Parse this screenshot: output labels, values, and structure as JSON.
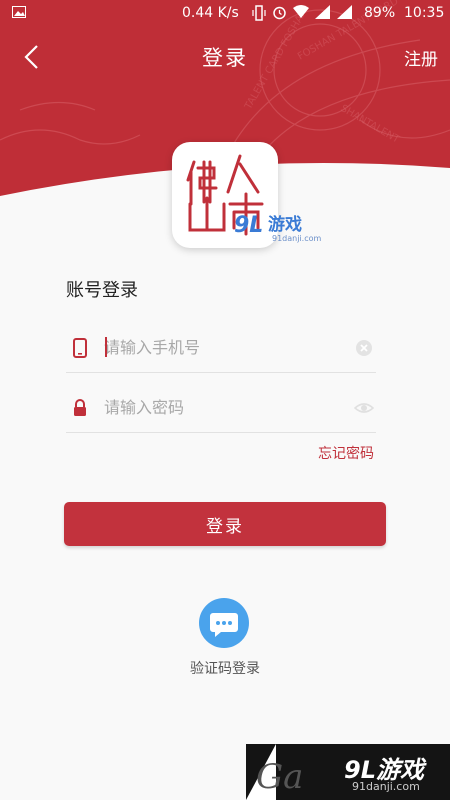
{
  "status_bar": {
    "speed": "0.44 K/s",
    "battery": "89%",
    "time": "10:35"
  },
  "header": {
    "title": "登录",
    "register_label": "注册",
    "back_icon": "chevron-left-icon",
    "banner_color": "#c0303a"
  },
  "logo": {
    "app_text_1": "佛",
    "app_text_2": "山",
    "app_text_3": "人",
    "app_text_4": "才",
    "watermark": "游戏",
    "watermark_site": "91danji.com"
  },
  "form": {
    "section_title": "账号登录",
    "phone_placeholder": "请输入手机号",
    "phone_value": "",
    "password_placeholder": "请输入密码",
    "password_value": "",
    "forgot_label": "忘记密码",
    "login_label": "登录"
  },
  "alt_login": {
    "sms_label": "验证码登录",
    "icon": "chat-bubble-icon",
    "color": "#4aa3ec"
  },
  "corner_watermark": {
    "brand": "9L游戏",
    "site": "91danji.com"
  }
}
